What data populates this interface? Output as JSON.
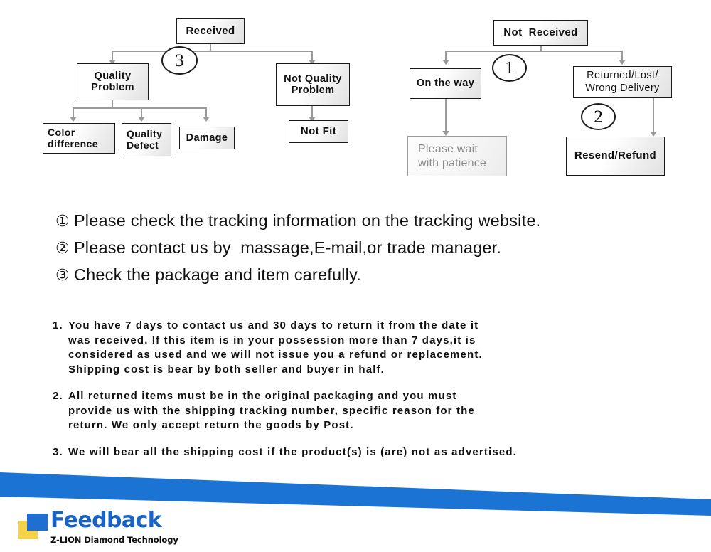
{
  "flowchart": {
    "left_tree": {
      "root": {
        "label": "Received"
      },
      "branches": [
        {
          "label": "Quality\nProblem"
        },
        {
          "label": "Not Quality\nProblem"
        }
      ],
      "quality_children": [
        {
          "label": "Color\ndifference"
        },
        {
          "label": "Quality\nDefect"
        },
        {
          "label": "Damage"
        }
      ],
      "not_quality_children": [
        {
          "label": "Not Fit"
        }
      ],
      "marker": "3"
    },
    "right_tree": {
      "root": {
        "label": "Not  Received"
      },
      "branches": [
        {
          "label": "On the way"
        },
        {
          "label": "Returned/Lost/\nWrong Delivery"
        }
      ],
      "on_the_way_child": {
        "label": "Please wait\nwith patience"
      },
      "returned_child": {
        "label": "Resend/Refund"
      },
      "marker_1": "1",
      "marker_2": "2"
    }
  },
  "instructions": [
    {
      "marker": "①",
      "text": "Please check the tracking information on the tracking website."
    },
    {
      "marker": "②",
      "text": "Please contact us by  massage,E-mail,or trade manager."
    },
    {
      "marker": "③",
      "text": "Check the package and item carefully."
    }
  ],
  "policy": [
    {
      "number": "1.",
      "lines": [
        "You have 7 days to contact us and 30 days to return it from the date it",
        "was received. If this item is in your possession more than 7 days,it is",
        "considered as used and we will not issue you a refund or replacement.",
        "Shipping cost is bear by both seller and buyer in half."
      ]
    },
    {
      "number": "2.",
      "lines": [
        "All returned items must be in the original packaging and you must",
        "provide us with the shipping tracking number, specific reason for the",
        "return. We only accept return the goods by Post."
      ]
    },
    {
      "number": "3.",
      "lines": [
        "We will bear all the shipping cost if the product(s) is (are) not as advertised."
      ]
    }
  ],
  "footer": {
    "logo_word": "Feedback",
    "tagline": "Z-LION Diamond Technology",
    "brand_blue": "#1763c6",
    "brand_yellow": "#f5d249",
    "band_blue": "#1b73d4"
  }
}
